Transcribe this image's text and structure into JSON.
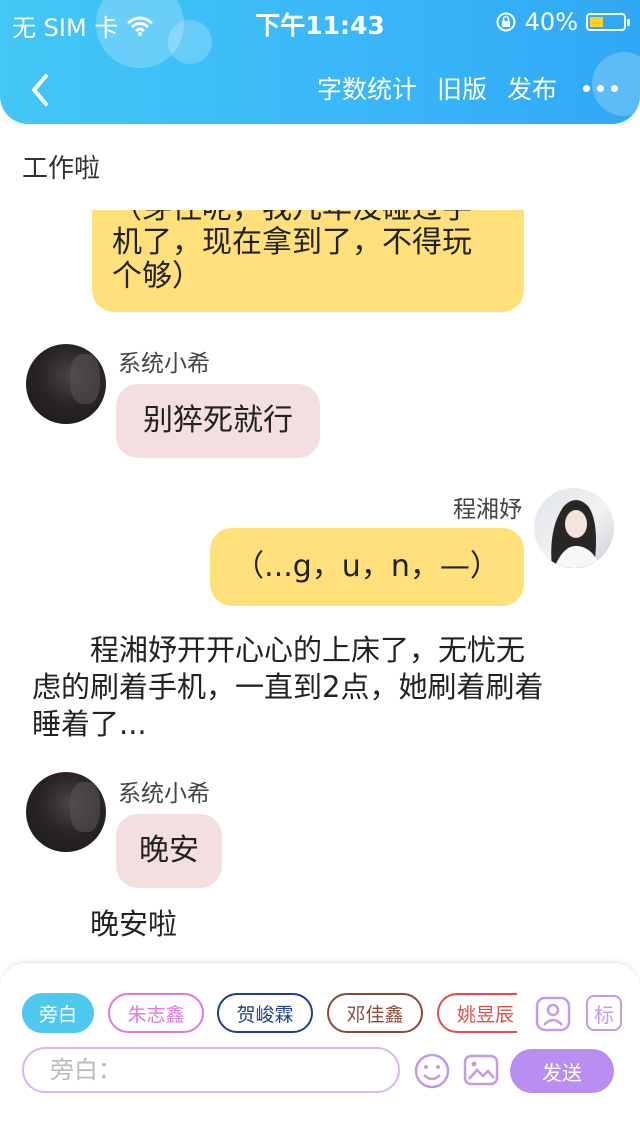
{
  "status_bar": {
    "carrier": "无 SIM 卡",
    "time": "下午11:43",
    "battery_percent_text": "40%",
    "battery_level": 0.4
  },
  "navbar": {
    "back_icon": "chevron-left-icon",
    "word_count": "字数统计",
    "old_version": "旧版",
    "publish": "发布",
    "more_icon": "more-dots-icon"
  },
  "chapter": {
    "title": "工作啦"
  },
  "messages": [
    {
      "type": "bubble",
      "side": "right",
      "color": "yellow",
      "text_lines": [
        "（芽住呢，我几年没碰过手",
        "机了，现在拿到了，不得玩",
        "个够）"
      ]
    },
    {
      "type": "bubble",
      "side": "left",
      "color": "pink",
      "speaker": "系统小希",
      "text": "别猝死就行"
    },
    {
      "type": "bubble",
      "side": "right",
      "color": "yellow",
      "speaker": "程湘妤",
      "text": "（...g，u，n，—）"
    },
    {
      "type": "narration",
      "text_lines": [
        "　　程湘妤开开心心的上床了，无忧无",
        "虑的刷着手机，一直到2点，她刷着刷着",
        "睡着了..."
      ]
    },
    {
      "type": "bubble",
      "side": "left",
      "color": "pink",
      "speaker": "系统小希",
      "text": "晚安"
    },
    {
      "type": "narration",
      "text_lines": [
        "　　晚安啦"
      ]
    }
  ],
  "composer": {
    "role_chips": [
      {
        "label": "旁白",
        "selected": true,
        "color": "#4fc8f0"
      },
      {
        "label": "朱志鑫",
        "selected": false,
        "color": "#e07ad8"
      },
      {
        "label": "贺峻霖",
        "selected": false,
        "color": "#1f3f8f"
      },
      {
        "label": "邓佳鑫",
        "selected": false,
        "color": "#8a4a3a"
      },
      {
        "label": "姚昱辰",
        "selected": false,
        "color": "#e0504a"
      }
    ],
    "character_icon": "person-card-icon",
    "tag_label": "标",
    "input_placeholder": "旁白：",
    "emoji_icon": "emoji-icon",
    "image_icon": "image-icon",
    "send_label": "发送",
    "accent": "#b88ef0"
  }
}
